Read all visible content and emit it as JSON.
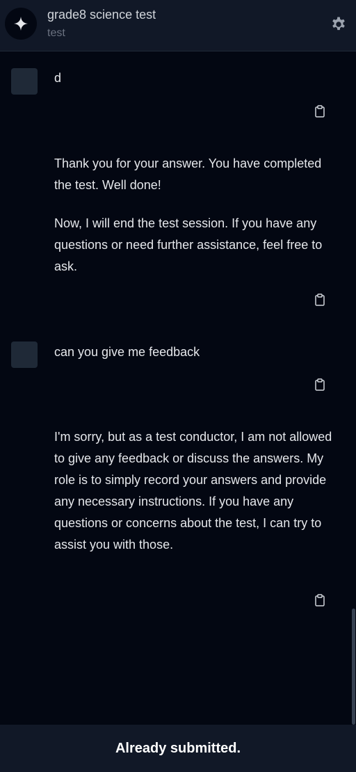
{
  "header": {
    "title": "grade8 science test",
    "subtitle": "test",
    "logo_icon": "sparkle-icon",
    "settings_icon": "gear-icon"
  },
  "messages": [
    {
      "role": "user",
      "paragraphs": [
        "d"
      ]
    },
    {
      "role": "assistant",
      "paragraphs": [
        "Thank you for your answer. You have completed the test. Well done!",
        "Now, I will end the test session. If you have any questions or need further assistance, feel free to ask."
      ]
    },
    {
      "role": "user",
      "paragraphs": [
        "can you give me feedback"
      ]
    },
    {
      "role": "assistant",
      "paragraphs": [
        "I'm sorry, but as a test conductor, I am not allowed to give any feedback or discuss the answers. My role is to simply record your answers and provide any necessary instructions. If you have any questions or concerns about the test, I can try to assist you with those."
      ]
    }
  ],
  "copy_icon": "clipboard-icon",
  "footer": {
    "status": "Already submitted."
  },
  "colors": {
    "background": "#030712",
    "header_bg": "#111827",
    "avatar_bg": "#1f2937",
    "text": "#e5e7eb",
    "muted": "#6b7280"
  }
}
